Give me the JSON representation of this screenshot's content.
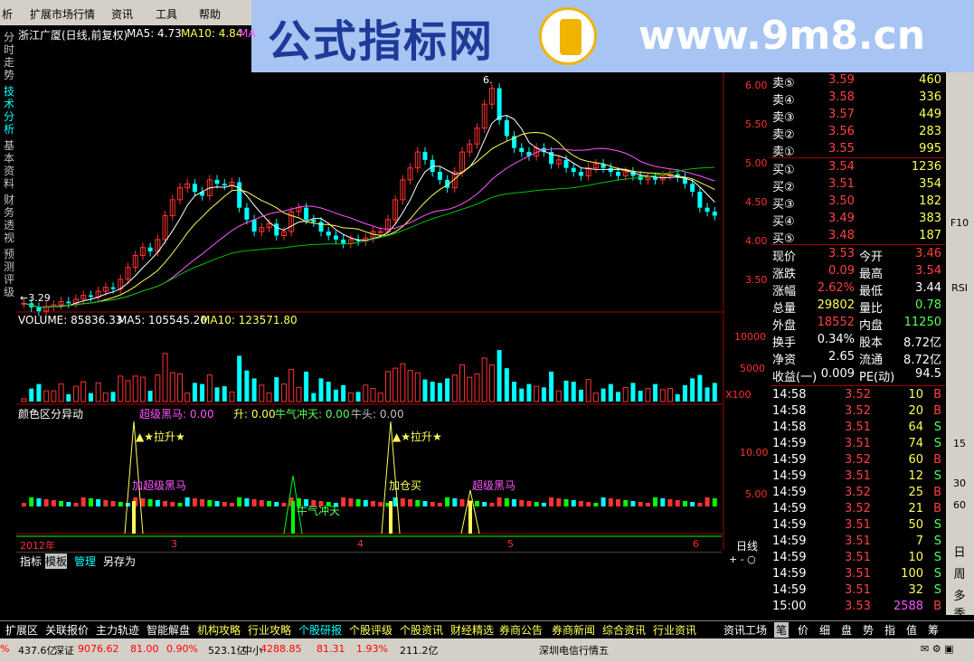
{
  "menu": {
    "items": [
      "析",
      "扩展市场行情",
      "资讯",
      "工具",
      "帮助"
    ]
  },
  "banner": {
    "left": "公式指标网",
    "right": "www.9m8.cn",
    "logo_text": "www.9m8.cn"
  },
  "leftnav": [
    "分时走势",
    "技术分析",
    "基本资料",
    "财务透视",
    "预测评级"
  ],
  "chart": {
    "title": "浙江广厦(日线,前复权)",
    "ma5": "MA5: 4.73",
    "ma10": "MA10: 4.84",
    "ma20": "MA",
    "low_marker": "←3.29",
    "high_marker": "6.",
    "price_ticks": [
      "6.00",
      "5.50",
      "5.00",
      "4.50",
      "4.00",
      "3.50"
    ],
    "vol_label": "VOLUME: 85836.33",
    "vol_ma5": "MA5: 105545.20",
    "vol_ma10": "MA10: 123571.80",
    "vol_ticks": [
      "10000",
      "5000"
    ],
    "vol_unit": "X100",
    "ind_title": "颜色区分异动",
    "ind_vals": [
      {
        "t": "超级黑马: 0.00",
        "c": "#ff55ff"
      },
      {
        "t": "升: 0.00",
        "c": "#ffff55"
      },
      {
        "t": "牛气冲天: 0.00",
        "c": "#55ff55"
      },
      {
        "t": "牛头: 0.00",
        "c": "#c0c0c0"
      }
    ],
    "ind_ticks": [
      "10.00",
      "5.00"
    ],
    "labels": [
      "▲★拉升★",
      "▲★拉升★",
      "加超级黑马",
      "加仓买",
      "超级黑马",
      "牛气冲天"
    ],
    "x_labels": [
      "2012年",
      "3",
      "4",
      "5",
      "6"
    ],
    "period": "日线"
  },
  "bottomtabs": [
    "指标",
    "模板",
    "管理",
    "另存为"
  ],
  "chart_data": {
    "type": "candlestick",
    "title": "浙江广厦(日线,前复权)",
    "ylim": [
      3.29,
      6.3
    ],
    "x_labels": [
      "2012年",
      "3",
      "4",
      "5",
      "6"
    ],
    "series": [
      {
        "name": "MA5",
        "last": 4.73
      },
      {
        "name": "MA10",
        "last": 4.84
      }
    ],
    "volume": {
      "last": 85836.33,
      "ma5": 105545.2,
      "ma10": 123571.8,
      "unit": "X100"
    }
  },
  "quote": {
    "sell": [
      [
        "卖⑤",
        "3.59",
        "460"
      ],
      [
        "卖④",
        "3.58",
        "336"
      ],
      [
        "卖③",
        "3.57",
        "449"
      ],
      [
        "卖②",
        "3.56",
        "283"
      ],
      [
        "卖①",
        "3.55",
        "995"
      ]
    ],
    "buy": [
      [
        "买①",
        "3.54",
        "1236"
      ],
      [
        "买②",
        "3.51",
        "354"
      ],
      [
        "买③",
        "3.50",
        "182"
      ],
      [
        "买④",
        "3.49",
        "383"
      ],
      [
        "买⑤",
        "3.48",
        "187"
      ]
    ],
    "stats": [
      [
        "现价",
        "3.53",
        "今开",
        "3.46",
        "#ff4040",
        "#ff4040"
      ],
      [
        "涨跌",
        "0.09",
        "最高",
        "3.54",
        "#ff4040",
        "#ff4040"
      ],
      [
        "涨幅",
        "2.62%",
        "最低",
        "3.44",
        "#ff4040",
        "#ffffff"
      ],
      [
        "总量",
        "29802",
        "量比",
        "0.78",
        "#ffff55",
        "#55ff55"
      ],
      [
        "外盘",
        "18552",
        "内盘",
        "11250",
        "#ff4040",
        "#55ff55"
      ],
      [
        "换手",
        "0.34%",
        "股本",
        "8.72亿",
        "#ffffff",
        "#ffffff"
      ],
      [
        "净资",
        "2.65",
        "流通",
        "8.72亿",
        "#ffffff",
        "#ffffff"
      ],
      [
        "收益(一)",
        "0.009",
        "PE(动)",
        "94.5",
        "#ffffff",
        "#ffffff"
      ]
    ],
    "ticks": [
      [
        "14:58",
        "3.52",
        "10",
        "B"
      ],
      [
        "14:58",
        "3.52",
        "20",
        "B"
      ],
      [
        "14:58",
        "3.51",
        "64",
        "S"
      ],
      [
        "14:59",
        "3.51",
        "74",
        "S"
      ],
      [
        "14:59",
        "3.52",
        "60",
        "B"
      ],
      [
        "14:59",
        "3.51",
        "12",
        "S"
      ],
      [
        "14:59",
        "3.52",
        "25",
        "B"
      ],
      [
        "14:59",
        "3.52",
        "21",
        "B"
      ],
      [
        "14:59",
        "3.51",
        "50",
        "S"
      ],
      [
        "14:59",
        "3.51",
        "7",
        "S"
      ],
      [
        "14:59",
        "3.51",
        "10",
        "S"
      ],
      [
        "14:59",
        "3.51",
        "100",
        "S"
      ],
      [
        "14:59",
        "3.51",
        "32",
        "S"
      ],
      [
        "15:00",
        "3.53",
        "2588",
        "B"
      ]
    ]
  },
  "rightbar": [
    "F10",
    "RSI",
    "15",
    "30",
    "60",
    "日",
    "周",
    "多",
    "季"
  ],
  "tabbar": [
    "扩展区",
    "关联报价",
    "主力轨迹",
    "智能解盘",
    "机构攻略",
    "行业攻略",
    "个股研报",
    "个股评级",
    "个股资讯",
    "财经精选",
    "券商公告",
    "券商新闻",
    "综合资讯",
    "行业资讯",
    "资讯工场",
    "笔",
    "价",
    "细",
    "盘",
    "势",
    "指",
    "值",
    "筹"
  ],
  "status": [
    {
      "t": "%",
      "c": "#ff0000"
    },
    {
      "t": "437.6亿",
      "c": "#000"
    },
    {
      "t": "深证",
      "c": "#000"
    },
    {
      "t": "9076.62",
      "c": "#ff0000"
    },
    {
      "t": "81.00",
      "c": "#ff0000"
    },
    {
      "t": "0.90%",
      "c": "#ff0000"
    },
    {
      "t": "523.1亿",
      "c": "#000"
    },
    {
      "t": "中小",
      "c": "#000"
    },
    {
      "t": "4288.85",
      "c": "#ff0000"
    },
    {
      "t": "81.31",
      "c": "#ff0000"
    },
    {
      "t": "1.93%",
      "c": "#ff0000"
    },
    {
      "t": "211.2亿",
      "c": "#000"
    },
    {
      "t": "深圳电信行情五",
      "c": "#000"
    }
  ]
}
